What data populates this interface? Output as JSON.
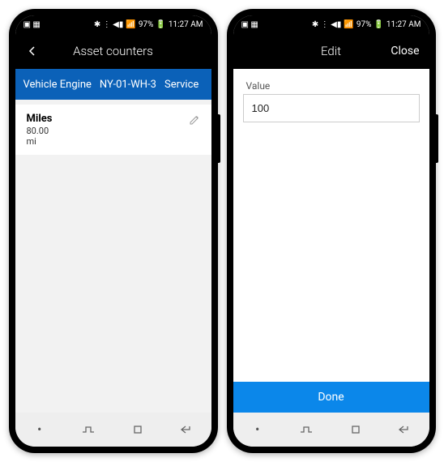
{
  "status": {
    "icons_left": "▣ ▦",
    "icons_right": "✱ ⋮ ◀▮",
    "signal": "📶",
    "battery_pct": "97%",
    "battery_icon": "🔋",
    "time": "11:27 AM"
  },
  "phone1": {
    "title": "Asset counters",
    "header": {
      "type": "Vehicle Engine",
      "id": "NY-01-WH-3",
      "svc": "Service"
    },
    "counter": {
      "name": "Miles",
      "value": "80.00",
      "unit": "mi"
    }
  },
  "phone2": {
    "title": "Edit",
    "close": "Close",
    "field_label": "Value",
    "field_value": "100",
    "done": "Done"
  },
  "nav": {
    "dot": "•"
  }
}
